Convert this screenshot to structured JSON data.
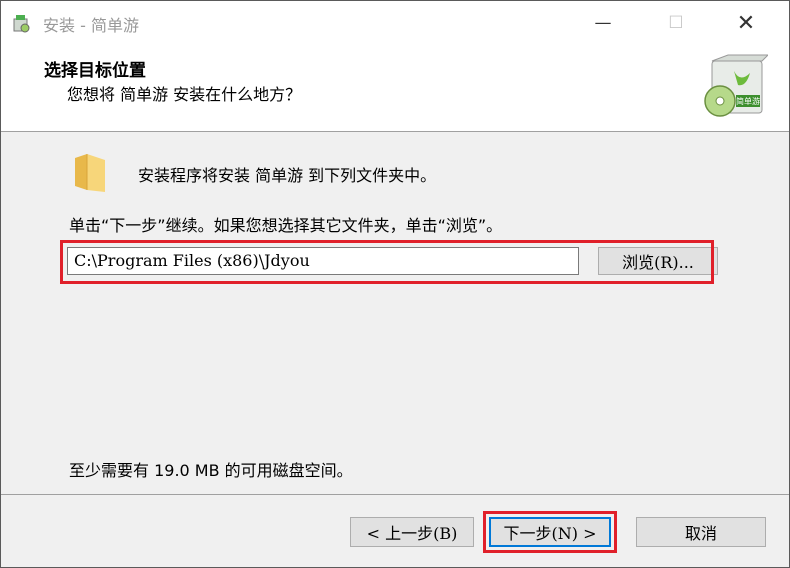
{
  "window": {
    "title": "安装 - 简单游",
    "controls": {
      "minimize": "—",
      "maximize": "☐",
      "close": "✕"
    }
  },
  "header": {
    "title": "选择目标位置",
    "subtitle": "您想将 简单游 安装在什么地方？",
    "logo_text": "简单游"
  },
  "content": {
    "folder_message": "安装程序将安装 简单游 到下列文件夹中。",
    "instruction": "单击“下一步”继续。如果您想选择其它文件夹，单击“浏览”。",
    "path_value": "C:\\Program Files (x86)\\Jdyou",
    "browse_label": "浏览(R)...",
    "space_message": "至少需要有 19.0 MB 的可用磁盘空间。"
  },
  "footer": {
    "back_label": "< 上一步(B)",
    "next_label": "下一步(N) >",
    "cancel_label": "取消"
  },
  "colors": {
    "highlight": "#e0202a",
    "focus": "#0078d7"
  }
}
